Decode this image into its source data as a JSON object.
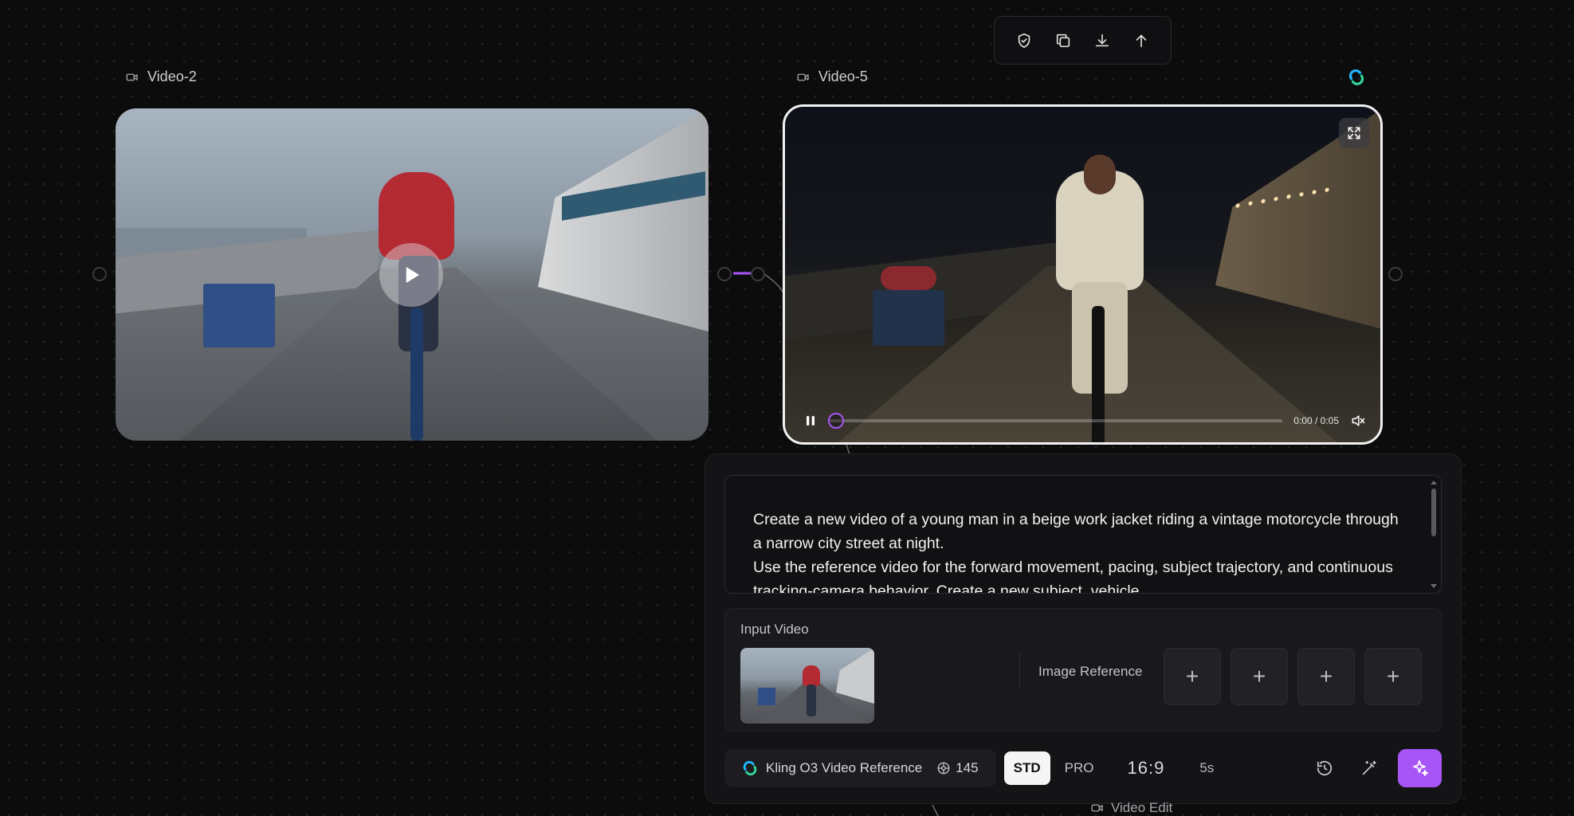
{
  "toolbar": {
    "icons": [
      "shield-icon",
      "copy-icon",
      "download-icon",
      "arrow-up-icon"
    ]
  },
  "nodes": {
    "video2": {
      "label": "Video-2"
    },
    "video5": {
      "label": "Video-5",
      "time": "0:00 / 0:05",
      "progress": 0
    }
  },
  "prompt": {
    "text": "Create a new video of a young man in a beige work jacket riding a vintage motorcycle through a narrow city street at night.\nUse the reference video for the forward movement, pacing, subject trajectory, and continuous tracking-camera behavior. Create a new subject, vehicle"
  },
  "inputs": {
    "input_video_label": "Input Video",
    "image_reference_label": "Image Reference",
    "slot_symbol": "+"
  },
  "bottom": {
    "model_name": "Kling O3 Video Reference",
    "credits": "145",
    "mode_std": "STD",
    "mode_pro": "PRO",
    "aspect_ratio": "16:9",
    "duration": "5s"
  },
  "below_node": {
    "label": "Video Edit"
  },
  "colors": {
    "accent": "#a855f7",
    "background": "#0c0c0d",
    "panel": "#141416"
  }
}
